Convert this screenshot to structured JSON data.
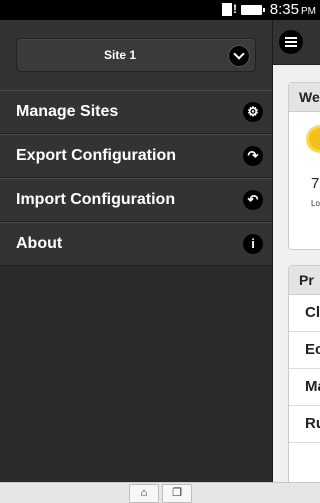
{
  "status_bar": {
    "time": "8:35",
    "ampm": "PM",
    "icons": [
      "sim-warning-icon",
      "battery-icon"
    ]
  },
  "menu": {
    "site_selector": {
      "value": "Site 1",
      "icon": "chevron-down-icon"
    },
    "items": [
      {
        "label": "Manage Sites",
        "icon": "gear-icon",
        "glyph": "⚙"
      },
      {
        "label": "Export Configuration",
        "icon": "redo-arrow-icon",
        "glyph": "↷"
      },
      {
        "label": "Import Configuration",
        "icon": "undo-arrow-icon",
        "glyph": "↶"
      },
      {
        "label": "About",
        "icon": "info-icon",
        "glyph": "i"
      }
    ]
  },
  "content": {
    "header_icon": "hamburger-menu-icon",
    "weather_panel": {
      "title": "We",
      "temperature": "7",
      "low_label": "Lo"
    },
    "programs_panel": {
      "title": "Pr",
      "rows": [
        "Cl",
        "Ec",
        "Ma",
        "Ru"
      ]
    }
  },
  "nav_bar": {
    "home_icon": "home-icon",
    "recent_icon": "recent-apps-icon"
  },
  "colors": {
    "menu_bg": "#333333",
    "panel_bg": "#2b2b2b",
    "icon_bg": "#000000",
    "sun": "#f2c01e"
  }
}
